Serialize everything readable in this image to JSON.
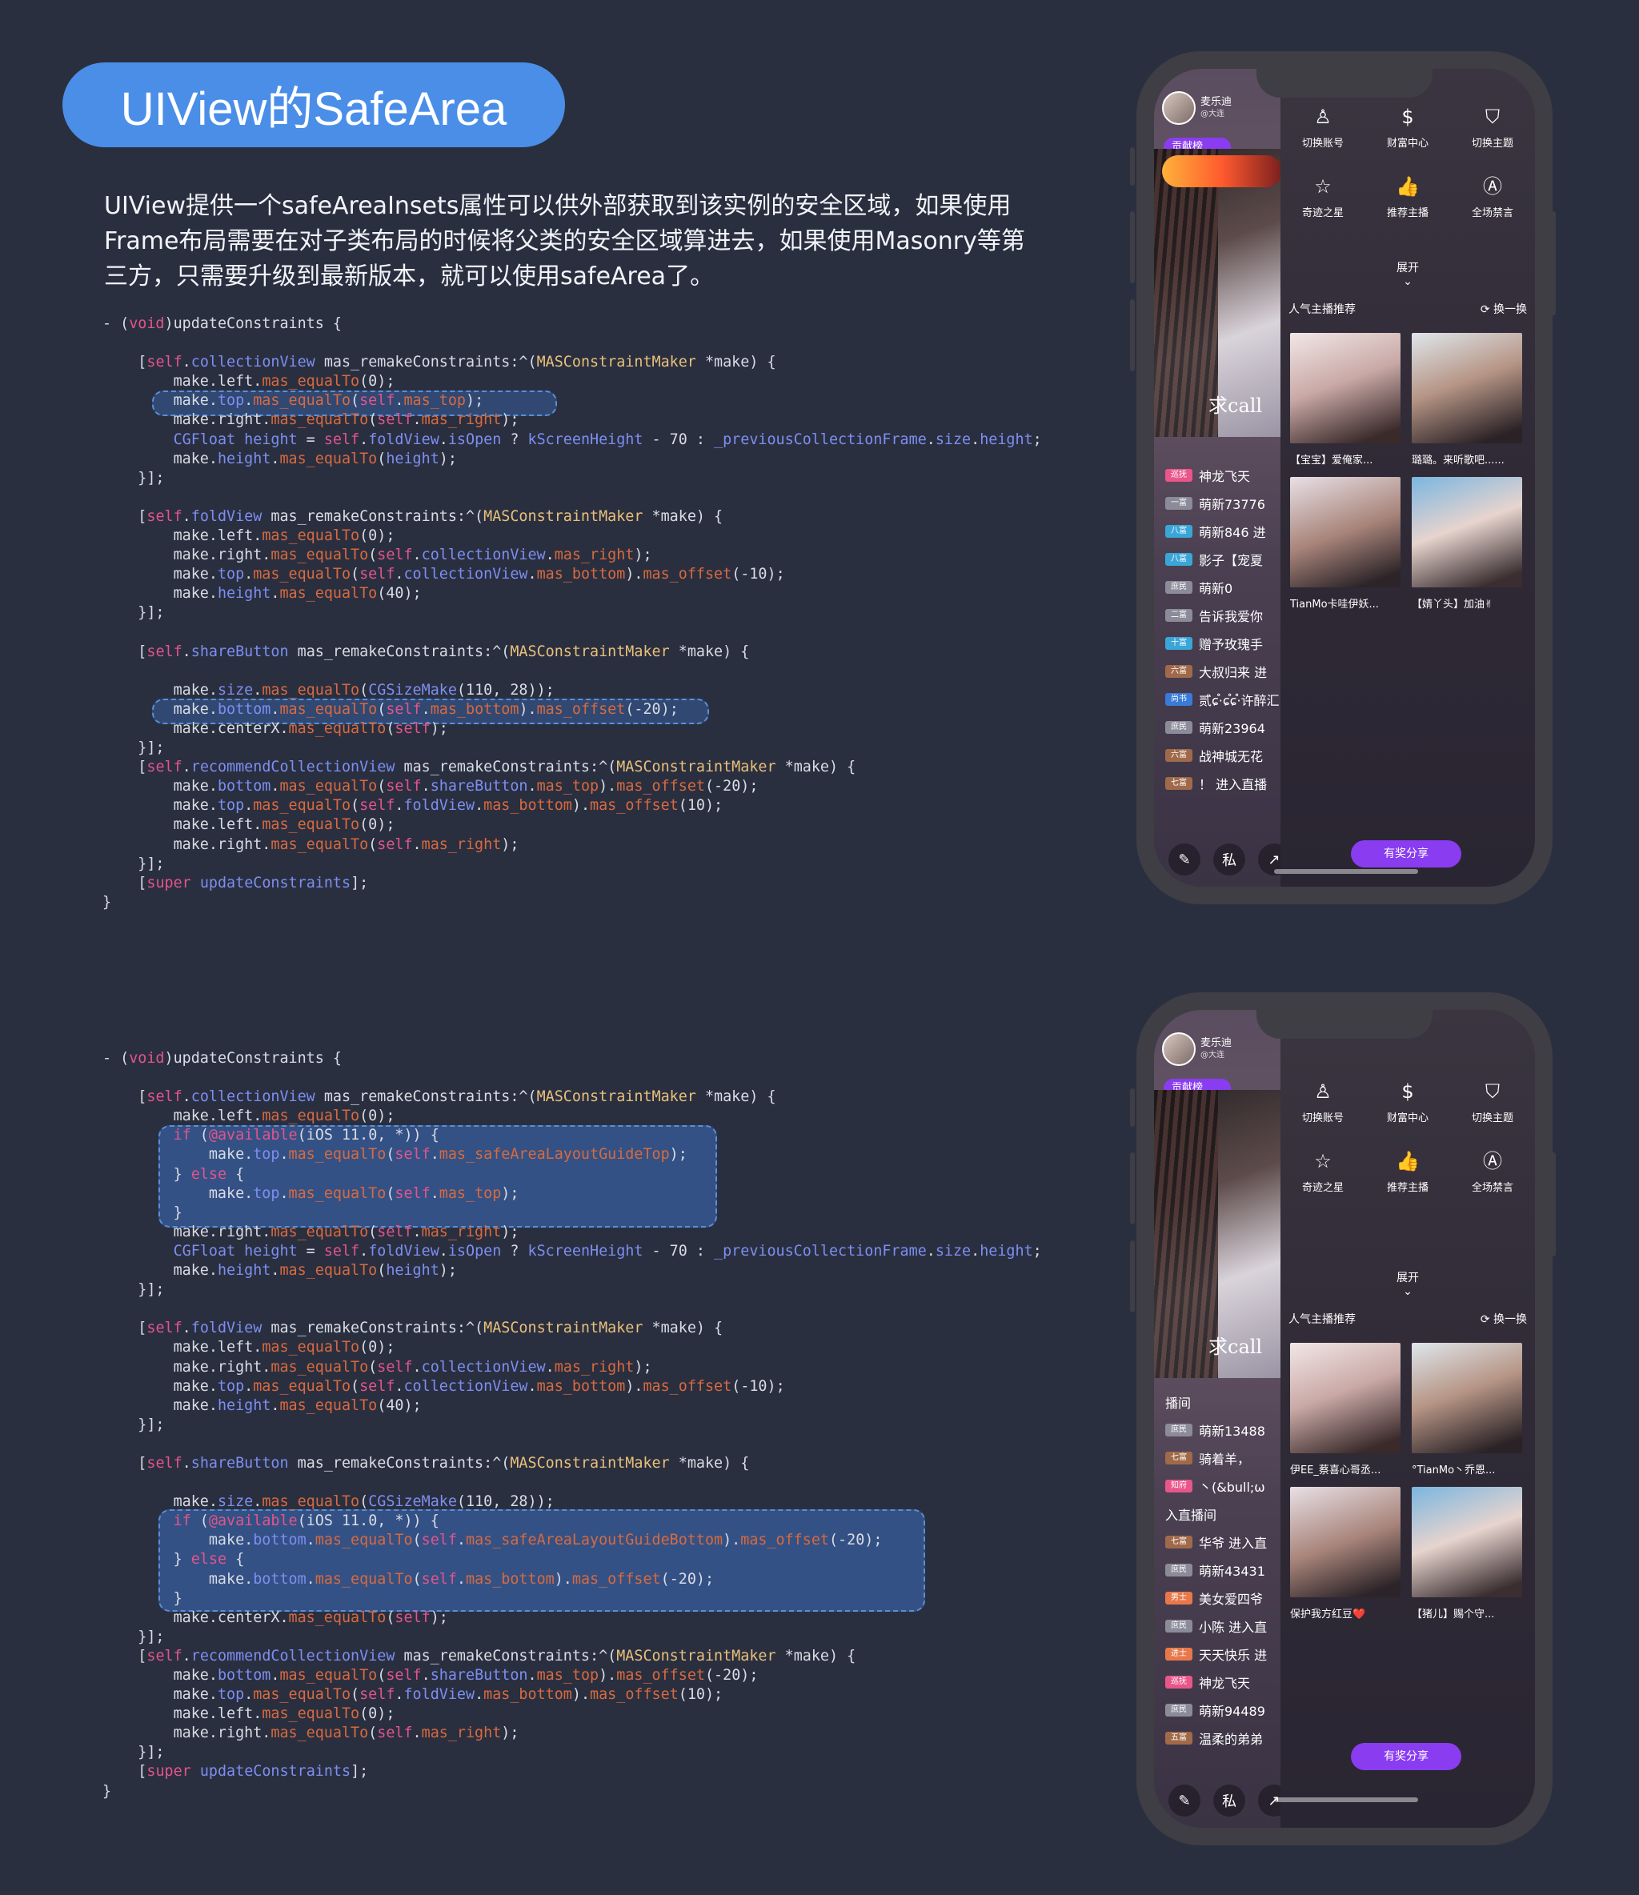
{
  "title": "UIView的SafeArea",
  "intro": "UIView提供一个safeAreaInsets属性可以供外部获取到该实例的安全区域，如果使用Frame布局需要在对子类布局的时候将父类的安全区域算进去，如果使用Masonry等第三方，只需要升级到最新版本，就可以使用safeArea了。",
  "code_top": [
    "- (void)updateConstraints {",
    "",
    "    [self.collectionView mas_remakeConstraints:^(MASConstraintMaker *make) {",
    "        make.left.mas_equalTo(0);",
    "        make.top.mas_equalTo(self.mas_top);",
    "        make.right.mas_equalTo(self.mas_right);",
    "        CGFloat height = self.foldView.isOpen ? kScreenHeight - 70 : _previousCollectionFrame.size.height;",
    "        make.height.mas_equalTo(height);",
    "    }];",
    "",
    "    [self.foldView mas_remakeConstraints:^(MASConstraintMaker *make) {",
    "        make.left.mas_equalTo(0);",
    "        make.right.mas_equalTo(self.collectionView.mas_right);",
    "        make.top.mas_equalTo(self.collectionView.mas_bottom).mas_offset(-10);",
    "        make.height.mas_equalTo(40);",
    "    }];",
    "",
    "    [self.shareButton mas_remakeConstraints:^(MASConstraintMaker *make) {",
    "",
    "        make.size.mas_equalTo(CGSizeMake(110, 28));",
    "        make.bottom.mas_equalTo(self.mas_bottom).mas_offset(-20);",
    "        make.centerX.mas_equalTo(self);",
    "    }];",
    "    [self.recommendCollectionView mas_remakeConstraints:^(MASConstraintMaker *make) {",
    "        make.bottom.mas_equalTo(self.shareButton.mas_top).mas_offset(-20);",
    "        make.top.mas_equalTo(self.foldView.mas_bottom).mas_offset(10);",
    "        make.left.mas_equalTo(0);",
    "        make.right.mas_equalTo(self.mas_right);",
    "    }];",
    "    [super updateConstraints];",
    "}"
  ],
  "code_bottom": [
    "- (void)updateConstraints {",
    "",
    "    [self.collectionView mas_remakeConstraints:^(MASConstraintMaker *make) {",
    "        make.left.mas_equalTo(0);",
    "        if (@available(iOS 11.0, *)) {",
    "            make.top.mas_equalTo(self.mas_safeAreaLayoutGuideTop);",
    "        } else {",
    "            make.top.mas_equalTo(self.mas_top);",
    "        }",
    "        make.right.mas_equalTo(self.mas_right);",
    "        CGFloat height = self.foldView.isOpen ? kScreenHeight - 70 : _previousCollectionFrame.size.height;",
    "        make.height.mas_equalTo(height);",
    "    }];",
    "",
    "    [self.foldView mas_remakeConstraints:^(MASConstraintMaker *make) {",
    "        make.left.mas_equalTo(0);",
    "        make.right.mas_equalTo(self.collectionView.mas_right);",
    "        make.top.mas_equalTo(self.collectionView.mas_bottom).mas_offset(-10);",
    "        make.height.mas_equalTo(40);",
    "    }];",
    "",
    "    [self.shareButton mas_remakeConstraints:^(MASConstraintMaker *make) {",
    "",
    "        make.size.mas_equalTo(CGSizeMake(110, 28));",
    "        if (@available(iOS 11.0, *)) {",
    "            make.bottom.mas_equalTo(self.mas_safeAreaLayoutGuideBottom).mas_offset(-20);",
    "        } else {",
    "            make.bottom.mas_equalTo(self.mas_bottom).mas_offset(-20);",
    "        }",
    "        make.centerX.mas_equalTo(self);",
    "    }];",
    "    [self.recommendCollectionView mas_remakeConstraints:^(MASConstraintMaker *make) {",
    "        make.bottom.mas_equalTo(self.shareButton.mas_top).mas_offset(-20);",
    "        make.top.mas_equalTo(self.foldView.mas_bottom).mas_offset(10);",
    "        make.left.mas_equalTo(0);",
    "        make.right.mas_equalTo(self.mas_right);",
    "    }];",
    "    [super updateConstraints];",
    "}"
  ],
  "phones": [
    {
      "host_name": "麦乐迪",
      "host_sub": "@大连",
      "rank_label": "贡献榜",
      "video_caption": "求call",
      "menu": [
        {
          "icon": "user-switch-icon",
          "glyph": "♙",
          "label": "切换账号"
        },
        {
          "icon": "coin-icon",
          "glyph": "$",
          "label": "财富中心"
        },
        {
          "icon": "shirt-icon",
          "glyph": "⛉",
          "label": "切换主题"
        },
        {
          "icon": "star-icon",
          "glyph": "☆",
          "label": "奇迹之星"
        },
        {
          "icon": "thumbs-up-icon",
          "glyph": "👍",
          "label": "推荐主播"
        },
        {
          "icon": "mute-all-icon",
          "glyph": "Ⓐ",
          "label": "全场禁言"
        }
      ],
      "expand": "展开",
      "rec_title": "人气主播推荐",
      "refresh": "换一换",
      "cards": [
        "【宝宝】爱俺家...",
        "璐璐。来听歌吧......",
        "TianMo卡哇伊妖...",
        "【婧丫头】加油✌"
      ],
      "chat": [
        {
          "tag": "巡抚",
          "color": "#e8568a",
          "text": "神龙飞天"
        },
        {
          "tag": "一富",
          "color": "#8b8b99",
          "text": "萌新73776"
        },
        {
          "tag": "八富",
          "color": "#3aa6d8",
          "text": "萌新846 进"
        },
        {
          "tag": "八富",
          "color": "#3aa6d8",
          "text": "影子【宠夏"
        },
        {
          "tag": "庶民",
          "color": "#8b8b99",
          "text": "萌新0"
        },
        {
          "tag": "二富",
          "color": "#8b8b99",
          "text": "告诉我爱你"
        },
        {
          "tag": "十富",
          "color": "#3aa6d8",
          "text": "赠予玫瑰手"
        },
        {
          "tag": "六富",
          "color": "#a06a4a",
          "text": "大叔归来 进"
        },
        {
          "tag": "尚书",
          "color": "#3a7ad8",
          "text": "贰ɕ֯·ɕ֯ɕ֯·许醉汇"
        },
        {
          "tag": "庶民",
          "color": "#8b8b99",
          "text": "萌新23964"
        },
        {
          "tag": "六富",
          "color": "#a06a4a",
          "text": "战神城无花"
        },
        {
          "tag": "七富",
          "color": "#a06a4a",
          "text": "！ 进入直播"
        }
      ],
      "share": "有奖分享"
    },
    {
      "host_name": "麦乐迪",
      "host_sub": "@大连",
      "rank_label": "贡献榜",
      "video_caption": "求call",
      "menu": [
        {
          "icon": "user-switch-icon",
          "glyph": "♙",
          "label": "切换账号"
        },
        {
          "icon": "coin-icon",
          "glyph": "$",
          "label": "财富中心"
        },
        {
          "icon": "shirt-icon",
          "glyph": "⛉",
          "label": "切换主题"
        },
        {
          "icon": "star-icon",
          "glyph": "☆",
          "label": "奇迹之星"
        },
        {
          "icon": "thumbs-up-icon",
          "glyph": "👍",
          "label": "推荐主播"
        },
        {
          "icon": "mute-all-icon",
          "glyph": "Ⓐ",
          "label": "全场禁言"
        }
      ],
      "expand": "展开",
      "rec_title": "人气主播推荐",
      "refresh": "换一换",
      "cards": [
        "伊EE_蔡喜心哥丞...",
        "°TianMo丶乔恩...",
        "保护我方红豆❤️",
        "【猪儿】赐个守..."
      ],
      "chat": [
        {
          "tag": "播间",
          "color": "transparent",
          "text": "播间"
        },
        {
          "tag": "庶民",
          "color": "#8b8b99",
          "text": "萌新13488"
        },
        {
          "tag": "七富",
          "color": "#a06a4a",
          "text": "骑着羊，"
        },
        {
          "tag": "知府",
          "color": "#e8568a",
          "text": "丶(&bull;ω"
        },
        {
          "tag": "",
          "color": "transparent",
          "text": "入直播间"
        },
        {
          "tag": "七富",
          "color": "#a06a4a",
          "text": "华爷 进入直"
        },
        {
          "tag": "庶民",
          "color": "#8b8b99",
          "text": "萌新43431"
        },
        {
          "tag": "男士",
          "color": "#e8784a",
          "text": "美女爱四爷"
        },
        {
          "tag": "庶民",
          "color": "#8b8b99",
          "text": "小陈 进入直"
        },
        {
          "tag": "进士",
          "color": "#e8784a",
          "text": "天天快乐 进"
        },
        {
          "tag": "巡抚",
          "color": "#e8568a",
          "text": "神龙飞天"
        },
        {
          "tag": "庶民",
          "color": "#8b8b99",
          "text": "萌新94489"
        },
        {
          "tag": "五富",
          "color": "#a06a4a",
          "text": "温柔的弟弟"
        }
      ],
      "share": "有奖分享"
    }
  ]
}
